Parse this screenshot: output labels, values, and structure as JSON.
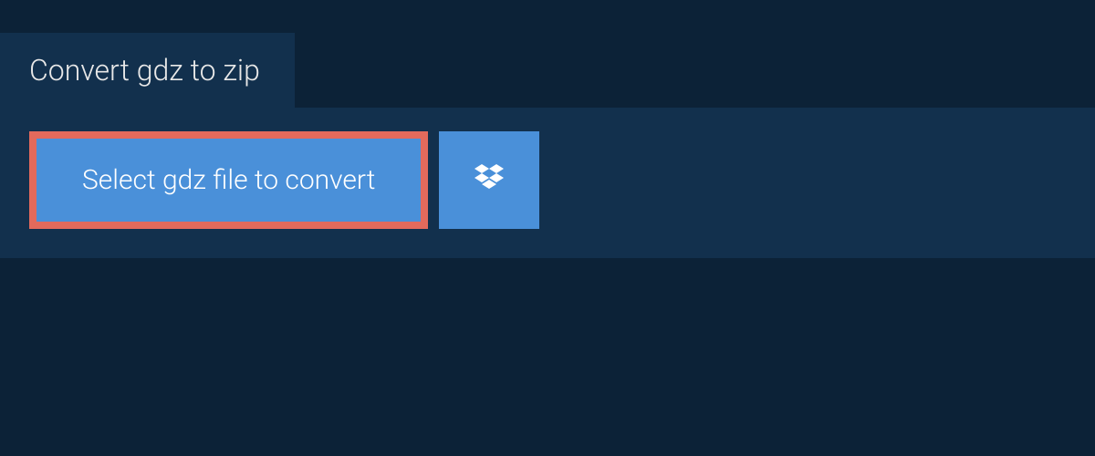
{
  "header": {
    "title": "Convert gdz to zip"
  },
  "panel": {
    "select_button_label": "Select gdz file to convert"
  },
  "colors": {
    "page_bg": "#0c2237",
    "panel_bg": "#12304d",
    "button_bg": "#4a90d9",
    "highlight_border": "#e36a5c",
    "text_light": "#ffffff"
  }
}
